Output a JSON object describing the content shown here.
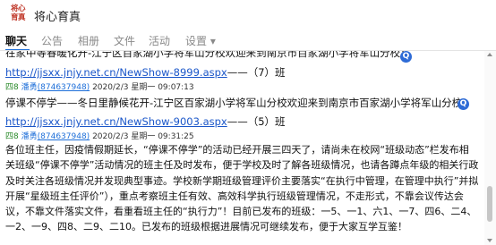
{
  "app": {
    "title": "将心育真",
    "logo_line1": "将心",
    "logo_line2": "育真"
  },
  "tabs": [
    {
      "label": "聊天",
      "active": true
    },
    {
      "label": "公告"
    },
    {
      "label": "相册"
    },
    {
      "label": "文件"
    },
    {
      "label": "活动"
    },
    {
      "label": "设置 ▾"
    }
  ],
  "messages": {
    "cut_top_text": "在家中等春暖化开-江宁区百家湖小学将军山分校欢迎来到南京市百家湖小学将军山分校！",
    "link1": {
      "url": "http://jjsxx.jnjy.net.cn/NewShow-8999.aspx",
      "tail": "——（7）班"
    },
    "meta1": {
      "tag": "四8",
      "name": "潘勇",
      "qq": "(874637948)",
      "datetime": "2020/2/3 星期一 09:07:13"
    },
    "msg2_text": "停课不停学——冬日里静候花开-江宁区百家湖小学将军山分校欢迎来到南京市百家湖小学将军山分校！",
    "link2": {
      "url": "http://jjsxx.jnjy.net.cn/NewShow-9003.aspx",
      "tail": "——（5）班"
    },
    "meta2": {
      "tag": "四8",
      "name": "潘勇",
      "qq": "(874637948)",
      "datetime": "2020/2/3 星期一 09:31:25"
    },
    "announcement_lines": [
      "各位班主任，因疫情假期延长，“停课不停学”的活动已经开展三四天了，请尚未在校网“班级动态”栏发布相",
      "关班级“停课不停学”活动情况的班主任及时发布，便于学校及时了解各班级情况，也请各蹲点年级的相关行政",
      "及时关注各班级情况并发现典型事迹。学校新学期班级管理评价主要落实“在执行中管理，在管理中执行”并拟",
      "开展“星级班主任评价”），重点考察班主任有效、高效科学执行班级管理情况，不走形式，不靠会议传达会",
      "议，不靠文件落实文件，看重看班主任的“执行力”！目前已发布的班级：一5、一1、六1、一7、四6、二4、",
      "一2、一9、四8、二9、二10。已发布的班级根据进展情况可继续发布，便于大家互学互鉴！"
    ],
    "translate_badge": "Q"
  },
  "colors": {
    "accent": "#1e6fd9",
    "link": "#1a56c9",
    "logo": "#c0392b",
    "badge": "#2e6bd6"
  }
}
